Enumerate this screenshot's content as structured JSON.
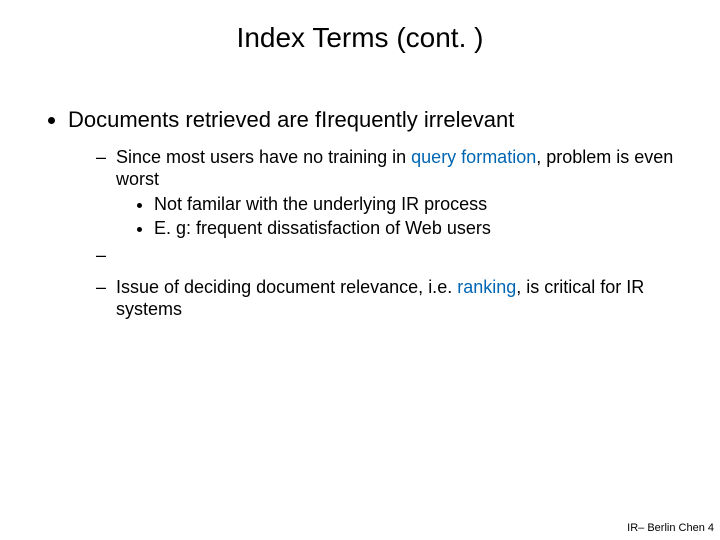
{
  "title": "Index Terms (cont. )",
  "bullets": {
    "lvl1_0": "Documents retrieved are fIrequently irrelevant",
    "lvl2_0_pre": "Since most users have no training in ",
    "lvl2_0_hl": "query formation",
    "lvl2_0_post": ", problem is even worst",
    "lvl3_0": "Not familar with the underlying IR process",
    "lvl3_1": "E. g: frequent dissatisfaction of Web users",
    "lvl2_1_pre": "Issue of deciding document relevance, i.e. ",
    "lvl2_1_hl": "ranking",
    "lvl2_1_post": ", is critical for IR systems"
  },
  "footer": "IR– Berlin Chen 4"
}
